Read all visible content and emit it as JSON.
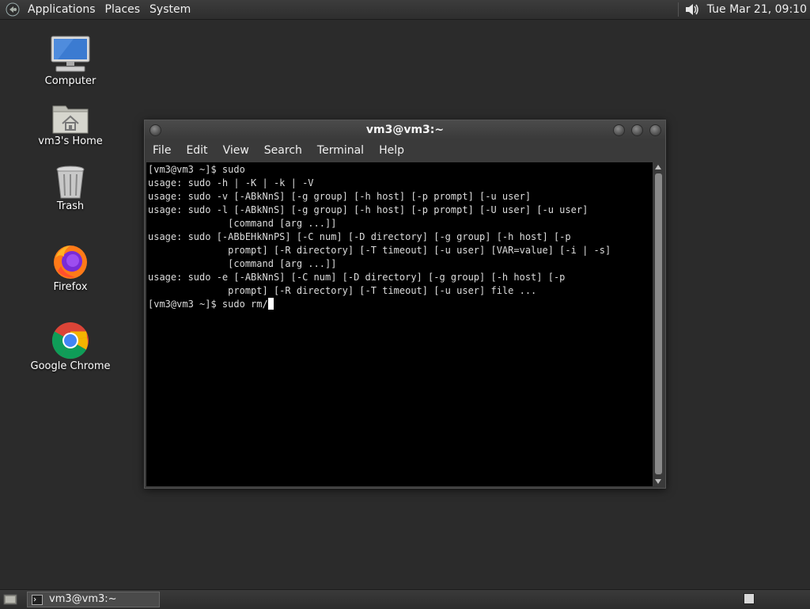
{
  "top_panel": {
    "menus": [
      "Applications",
      "Places",
      "System"
    ],
    "icons": {
      "logo": "gnome-foot-icon",
      "volume": "speaker-volume-icon"
    },
    "clock": "Tue Mar 21, 09:10"
  },
  "desktop_icons": [
    {
      "label": "Computer",
      "icon": "computer-monitor-icon"
    },
    {
      "label": "vm3's Home",
      "icon": "home-folder-icon"
    },
    {
      "label": "Trash",
      "icon": "trash-can-icon"
    },
    {
      "label": "Firefox",
      "icon": "firefox-icon"
    },
    {
      "label": "Google Chrome",
      "icon": "chrome-icon"
    }
  ],
  "terminal": {
    "title": "vm3@vm3:~",
    "menus": [
      "File",
      "Edit",
      "View",
      "Search",
      "Terminal",
      "Help"
    ],
    "lines": [
      "[vm3@vm3 ~]$ sudo",
      "usage: sudo -h | -K | -k | -V",
      "usage: sudo -v [-ABkNnS] [-g group] [-h host] [-p prompt] [-u user]",
      "usage: sudo -l [-ABkNnS] [-g group] [-h host] [-p prompt] [-U user] [-u user]",
      "              [command [arg ...]]",
      "usage: sudo [-ABbEHkNnPS] [-C num] [-D directory] [-g group] [-h host] [-p",
      "              prompt] [-R directory] [-T timeout] [-u user] [VAR=value] [-i | -s]",
      "              [command [arg ...]]",
      "usage: sudo -e [-ABkNnS] [-C num] [-D directory] [-g group] [-h host] [-p",
      "              prompt] [-R directory] [-T timeout] [-u user] file ..."
    ],
    "prompt_line": "[vm3@vm3 ~]$ sudo rm/"
  },
  "bottom_panel": {
    "task_label": "vm3@vm3:~",
    "icons": {
      "show_desktop": "show-desktop-icon",
      "task": "terminal-icon",
      "workspace": "workspace-switcher-icon"
    }
  },
  "colors": {
    "desktop": "#2b2b2b",
    "panel": "#333333",
    "terminal_bg": "#000000",
    "terminal_fg": "#dcdcdc"
  }
}
